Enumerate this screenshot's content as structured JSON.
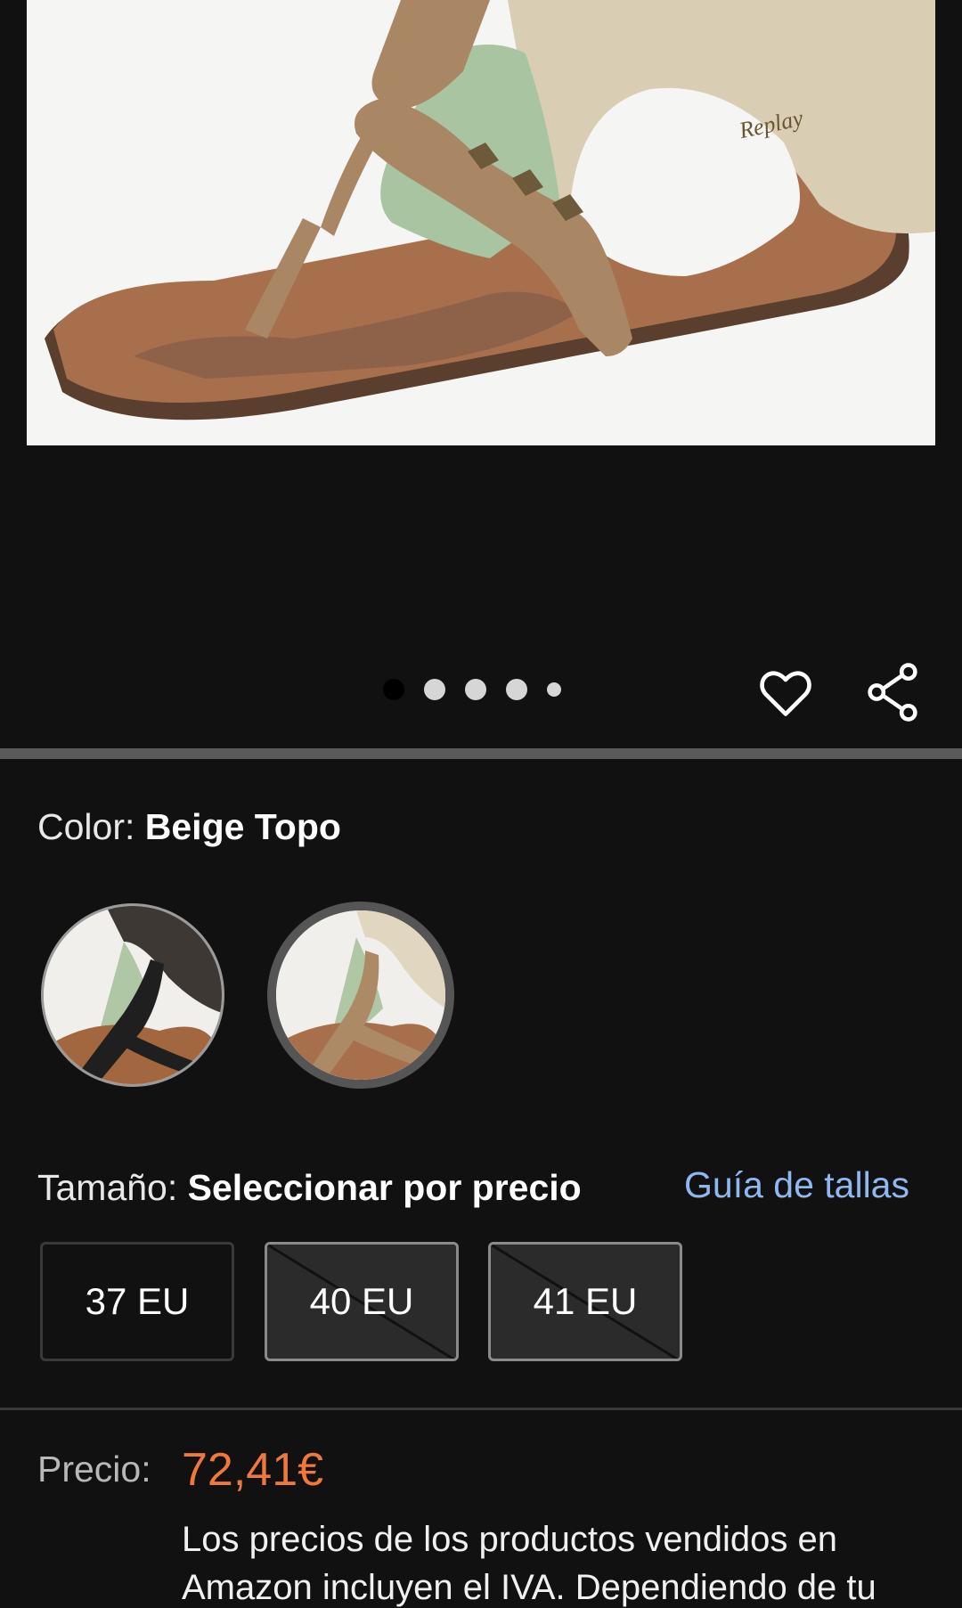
{
  "gallery": {
    "image_alt": "Sandalia Replay beige topo",
    "dots": [
      "active",
      "normal",
      "normal",
      "normal",
      "small"
    ]
  },
  "actions": {
    "favorite_icon": "heart-outline-icon",
    "share_icon": "share-icon"
  },
  "color": {
    "label": "Color: ",
    "selected": "Beige Topo",
    "options": [
      "Negro",
      "Beige Topo"
    ],
    "selected_index": 1
  },
  "size": {
    "label": "Tamaño: ",
    "selected": "Seleccionar por precio",
    "guide_link": "Guía de tallas",
    "options": [
      {
        "label": "37 EU",
        "available": true
      },
      {
        "label": "40 EU",
        "available": false
      },
      {
        "label": "41 EU",
        "available": false
      }
    ]
  },
  "price": {
    "label": "Precio:",
    "value": "72,41€",
    "note_line1": "Los precios de los productos vendidos en",
    "note_line2": "Amazon incluyen el IVA. Dependiendo de tu"
  },
  "colors": {
    "background": "#111111",
    "price": "#f0793a",
    "link": "#8fb7f0"
  }
}
